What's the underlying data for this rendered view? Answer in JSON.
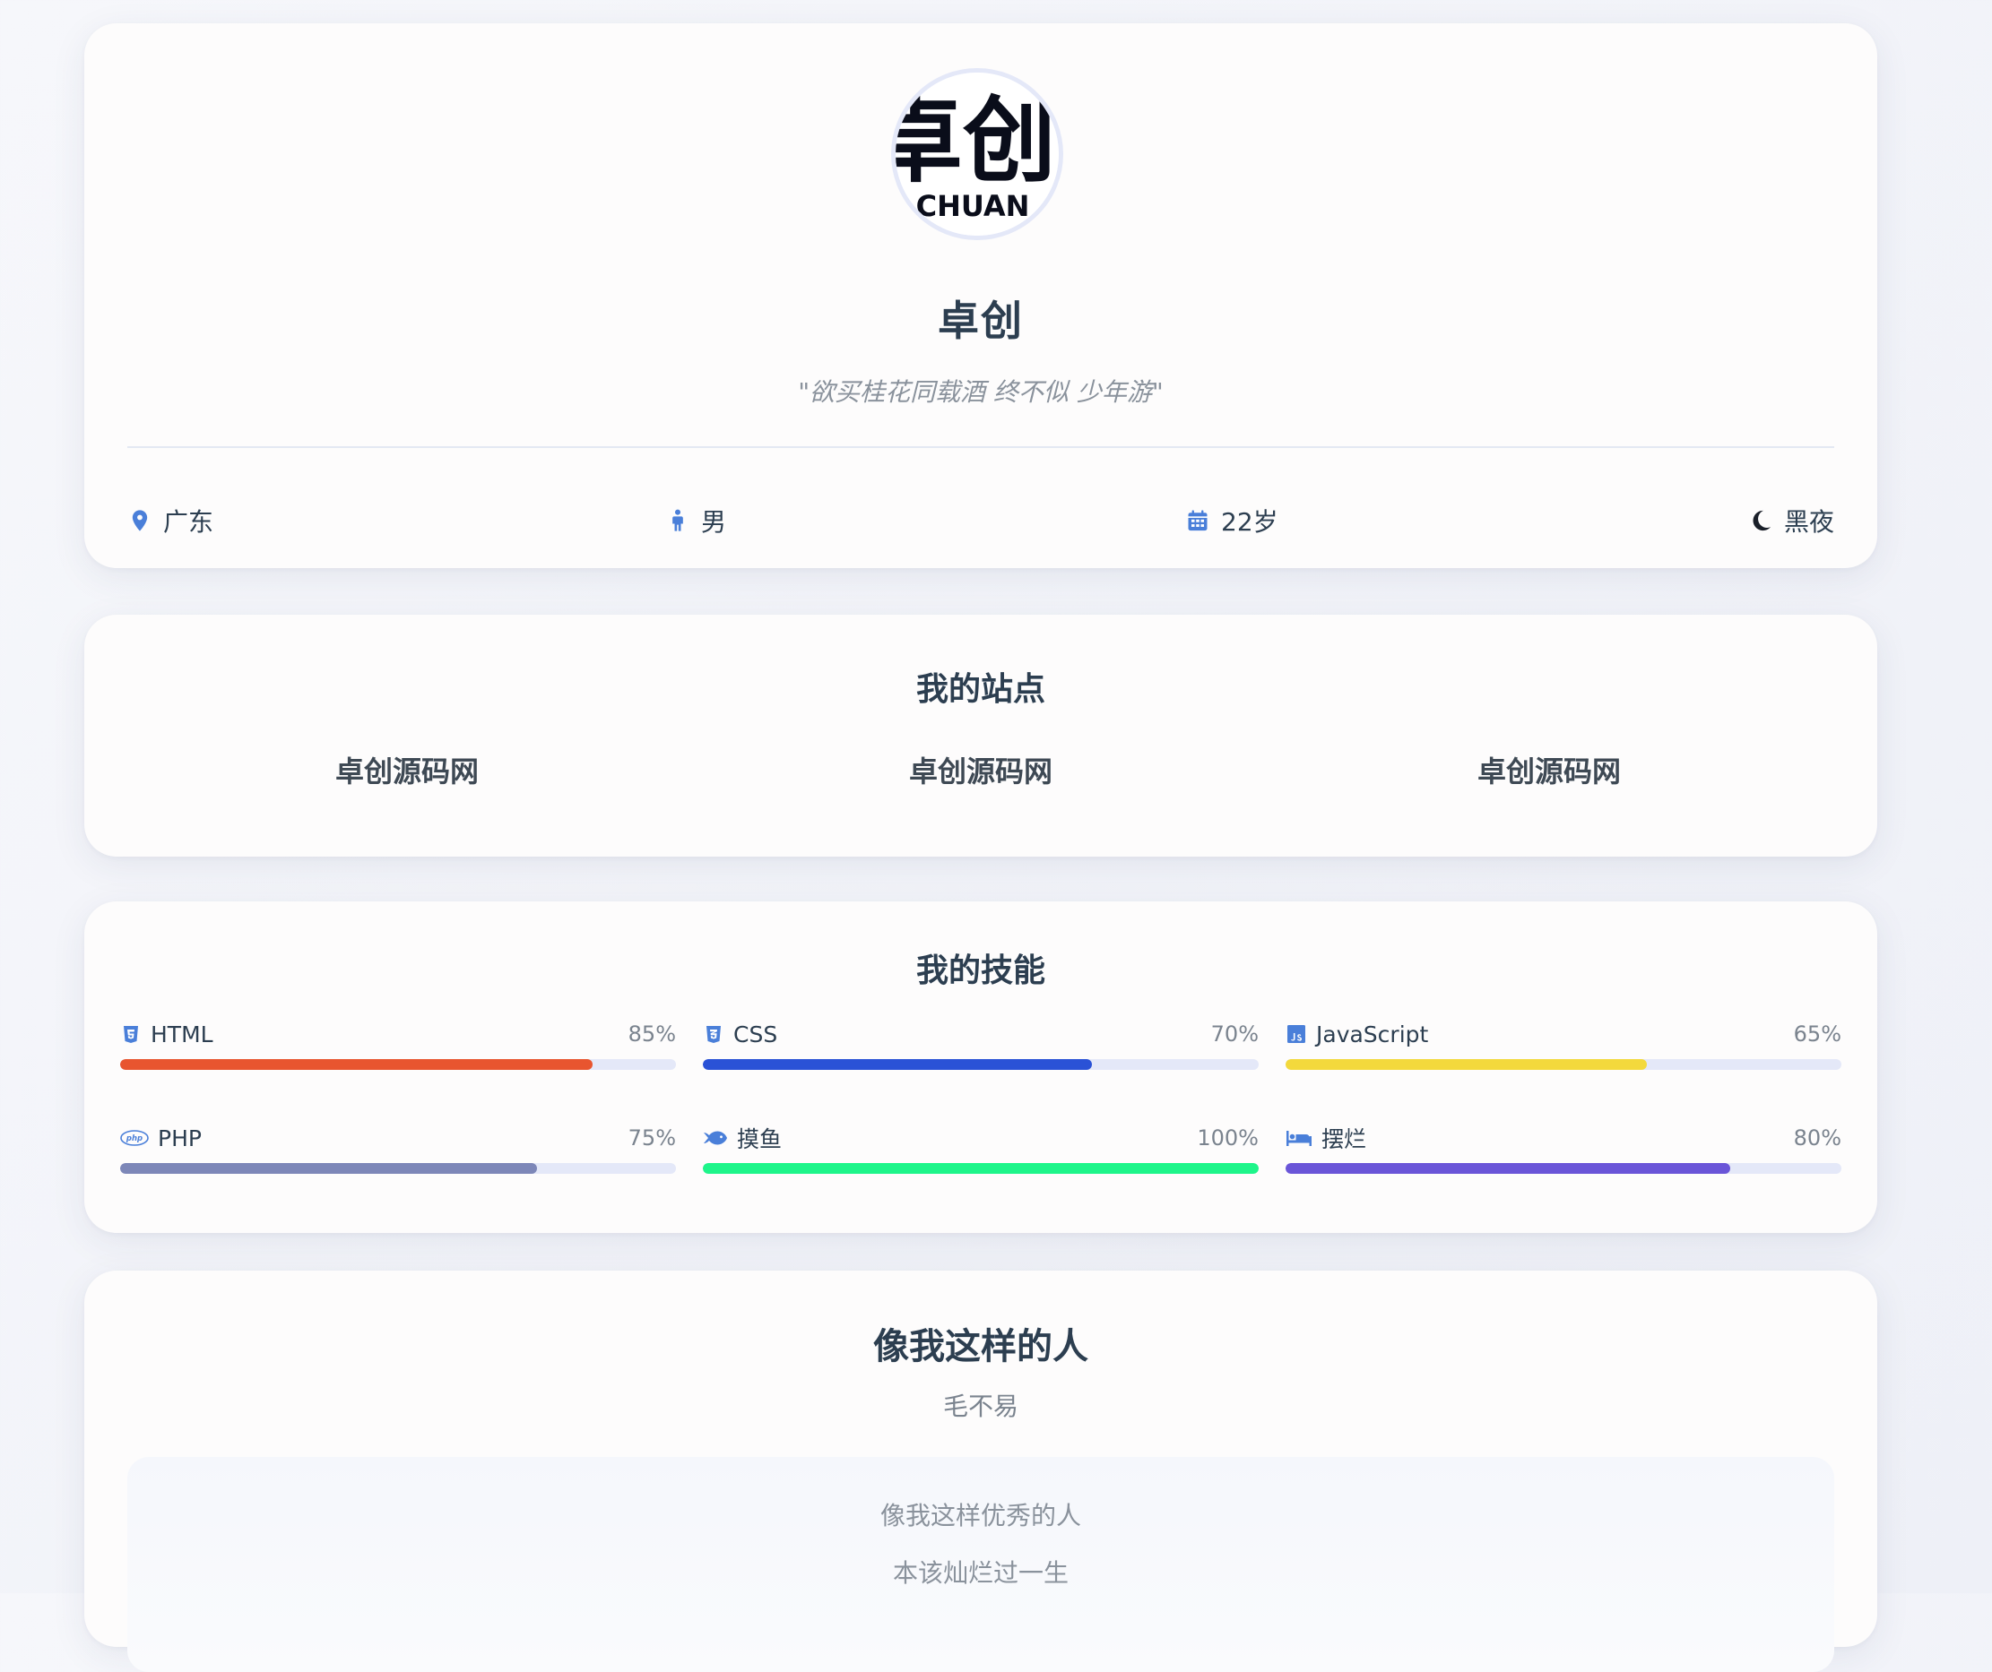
{
  "profile": {
    "avatar_text_top": "卓创",
    "avatar_text_bottom": "CHUAN",
    "name": "卓创",
    "motto": "\"欲买桂花同载酒 终不似 少年游\"",
    "info": {
      "location": "广东",
      "gender": "男",
      "age": "22岁",
      "mode": "黑夜"
    },
    "icons": {
      "location": "map-pin-icon",
      "gender": "male-person-icon",
      "age": "calendar-icon",
      "mode": "moon-icon"
    },
    "accent_color": "#4a7fd9"
  },
  "sites": {
    "title": "我的站点",
    "links": [
      "卓创源码网",
      "卓创源码网",
      "卓创源码网"
    ]
  },
  "skills": {
    "title": "我的技能",
    "items": [
      {
        "name": "HTML",
        "percent_label": "85%",
        "value": 85,
        "color": "#e8552f",
        "icon": "html5-icon"
      },
      {
        "name": "CSS",
        "percent_label": "70%",
        "value": 70,
        "color": "#2a52d6",
        "icon": "css3-icon"
      },
      {
        "name": "JavaScript",
        "percent_label": "65%",
        "value": 65,
        "color": "#f3d93c",
        "icon": "javascript-icon"
      },
      {
        "name": "PHP",
        "percent_label": "75%",
        "value": 75,
        "color": "#7d87b8",
        "icon": "php-icon"
      },
      {
        "name": "摸鱼",
        "percent_label": "100%",
        "value": 100,
        "color": "#1ef58a",
        "icon": "fish-icon"
      },
      {
        "name": "摆烂",
        "percent_label": "80%",
        "value": 80,
        "color": "#6a55d8",
        "icon": "bed-icon"
      }
    ]
  },
  "poem": {
    "title": "像我这样的人",
    "author": "毛不易",
    "lines": [
      "像我这样优秀的人",
      "本该灿烂过一生"
    ]
  }
}
